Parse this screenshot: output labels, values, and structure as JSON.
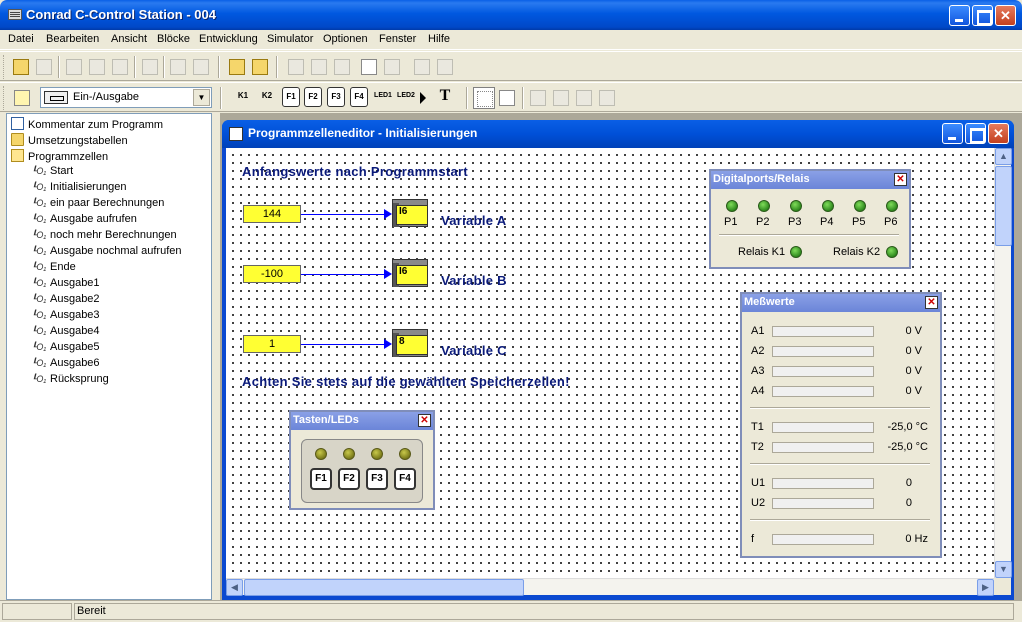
{
  "app": {
    "title": "Conrad C-Control Station - 004"
  },
  "menu": [
    "Datei",
    "Bearbeiten",
    "Ansicht",
    "Blöcke",
    "Entwicklung",
    "Simulator",
    "Optionen",
    "Fenster",
    "Hilfe"
  ],
  "toolbar2": {
    "combo_value": "Ein-/Ausgabe",
    "buttons": [
      "K1",
      "K2",
      "F1",
      "F2",
      "F3",
      "F4",
      "LED1",
      "LED2",
      "T"
    ]
  },
  "tree": {
    "items": [
      {
        "label": "Kommentar zum Programm",
        "type": "doc",
        "level": 0
      },
      {
        "label": "Umsetzungstabellen",
        "type": "folder",
        "level": 0
      },
      {
        "label": "Programmzellen",
        "type": "folder-open",
        "level": 0
      },
      {
        "label": "Start",
        "type": "cell",
        "level": 1
      },
      {
        "label": "Initialisierungen",
        "type": "cell",
        "level": 1
      },
      {
        "label": "ein paar Berechnungen",
        "type": "cell",
        "level": 1
      },
      {
        "label": "Ausgabe aufrufen",
        "type": "cell",
        "level": 1
      },
      {
        "label": "noch mehr Berechnungen",
        "type": "cell",
        "level": 1
      },
      {
        "label": "Ausgabe nochmal aufrufen",
        "type": "cell",
        "level": 1
      },
      {
        "label": "Ende",
        "type": "cell",
        "level": 1
      },
      {
        "label": "Ausgabe1",
        "type": "cell",
        "level": 1
      },
      {
        "label": "Ausgabe2",
        "type": "cell",
        "level": 1
      },
      {
        "label": "Ausgabe3",
        "type": "cell",
        "level": 1
      },
      {
        "label": "Ausgabe4",
        "type": "cell",
        "level": 1
      },
      {
        "label": "Ausgabe5",
        "type": "cell",
        "level": 1
      },
      {
        "label": "Ausgabe6",
        "type": "cell",
        "level": 1
      },
      {
        "label": "Rücksprung",
        "type": "cell",
        "level": 1
      }
    ],
    "cell_icon_text": "┖O₁"
  },
  "editor": {
    "title": "Programmzelleneditor - Initialisierungen",
    "heading": "Anfangswerte nach Programmstart",
    "warning": "Achten Sie stets auf die gewählten Speicherzellen!",
    "variables": [
      {
        "value": "144",
        "cell": "I6",
        "name": "Variable A"
      },
      {
        "value": "-100",
        "cell": "I6",
        "name": "Variable B"
      },
      {
        "value": "1",
        "cell": "8",
        "name": "Variable C"
      }
    ]
  },
  "digital": {
    "title": "Digitalports/Relais",
    "ports": [
      "P1",
      "P2",
      "P3",
      "P4",
      "P5",
      "P6"
    ],
    "relays": [
      "Relais K1",
      "Relais K2"
    ]
  },
  "tasten": {
    "title": "Tasten/LEDs",
    "keys": [
      "F1",
      "F2",
      "F3",
      "F4"
    ]
  },
  "mess": {
    "title": "Meßwerte",
    "rows": [
      {
        "label": "A1",
        "value": "0 V"
      },
      {
        "label": "A2",
        "value": "0 V"
      },
      {
        "label": "A3",
        "value": "0 V"
      },
      {
        "label": "A4",
        "value": "0 V"
      },
      {
        "label": "T1",
        "value": "-25,0 °C"
      },
      {
        "label": "T2",
        "value": "-25,0 °C"
      },
      {
        "label": "U1",
        "value": "0"
      },
      {
        "label": "U2",
        "value": "0"
      },
      {
        "label": "f",
        "value": "0 Hz"
      }
    ]
  },
  "status": {
    "text": "Bereit"
  },
  "colors": {
    "titlebar": "#0054e3",
    "canvas_text": "#0a1a7a",
    "value_box": "#ffff33",
    "connector": "#0000ff",
    "led_green": "#3fa02a"
  }
}
